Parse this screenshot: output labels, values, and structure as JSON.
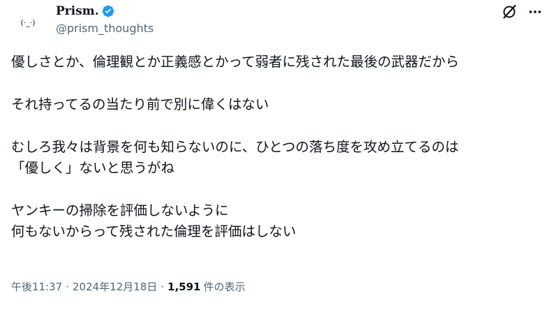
{
  "author": {
    "avatar_text": "(·_·)",
    "display_name": "Prism.",
    "handle": "@prism_thoughts",
    "verified_color": "#1d9bf0"
  },
  "actions": {
    "grok_icon": "grok-slash-circle-icon",
    "more_icon": "more-horizontal-icon"
  },
  "tweet": {
    "lines": [
      "優しさとか、倫理観とか正義感とかって弱者に残された最後の武器だから",
      "",
      "それ持ってるの当たり前で別に偉くはない",
      "",
      "むしろ我々は背景を何も知らないのに、ひとつの落ち度を攻め立てるのは",
      "「優しく」ないと思うがね",
      "",
      "ヤンキーの掃除を評価しないように",
      "何もないからって残された倫理を評価はしない"
    ]
  },
  "meta": {
    "time": "午後11:37",
    "separator": "·",
    "date": "2024年12月18日",
    "views_count": "1,591",
    "views_label": "件の表示"
  }
}
